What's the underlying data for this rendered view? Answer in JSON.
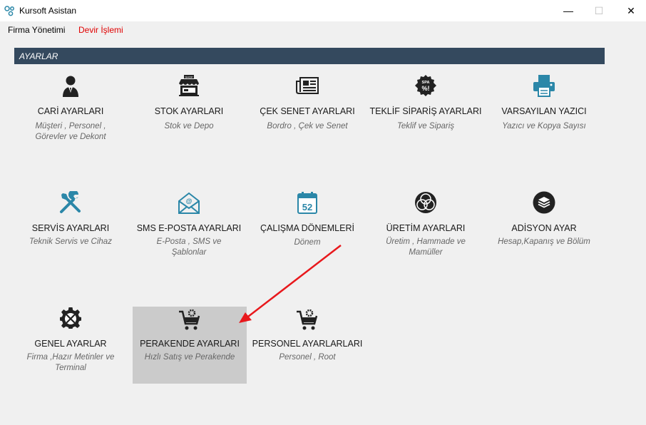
{
  "window": {
    "title": "Kursoft Asistan",
    "controls": {
      "minimize": "—",
      "maximize": "☐",
      "close": "✕"
    }
  },
  "menu": [
    {
      "label": "Firma Yönetimi"
    },
    {
      "label": "Devir İşlemi"
    }
  ],
  "section": {
    "title": "AYARLAR"
  },
  "tiles": [
    {
      "label": "CARİ AYARLARI",
      "sub": "Müşteri , Personel , Görevler ve Dekont",
      "icon": "user-icon"
    },
    {
      "label": "STOK AYARLARI",
      "sub": "Stok ve Depo",
      "icon": "shop-icon"
    },
    {
      "label": "ÇEK SENET AYARLARI",
      "sub": "Bordro , Çek ve Senet",
      "icon": "newspaper-icon"
    },
    {
      "label": "TEKLİF SİPARİŞ AYARLARI",
      "sub": "Teklif ve Sipariş",
      "icon": "spa-discount-icon"
    },
    {
      "label": "VARSAYILAN YAZICI",
      "sub": "Yazıcı ve Kopya Sayısı",
      "icon": "printer-icon"
    },
    {
      "label": "SERVİS AYARLARI",
      "sub": "Teknik Servis ve Cihaz",
      "icon": "tools-icon"
    },
    {
      "label": "SMS E-POSTA AYARLARI",
      "sub": "E-Posta , SMS ve Şablonlar",
      "icon": "email-icon"
    },
    {
      "label": "ÇALIŞMA DÖNEMLERİ",
      "sub": "Dönem",
      "icon": "calendar-icon"
    },
    {
      "label": "ÜRETİM AYARLARI",
      "sub": "Üretim , Hammade ve Mamüller",
      "icon": "circles-icon"
    },
    {
      "label": "ADİSYON AYAR",
      "sub": "Hesap,Kapanış ve Bölüm",
      "icon": "layers-icon"
    },
    {
      "label": "GENEL AYARLAR",
      "sub": "Firma ,Hazır Metinler ve Terminal",
      "icon": "gear-tools-icon"
    },
    {
      "label": "PERAKENDE AYARLARI",
      "sub": "Hızlı Satış ve Perakende",
      "icon": "cart-gear-icon"
    },
    {
      "label": "PERSONEL AYARLARLARI",
      "sub": "Personel , Root",
      "icon": "cart-gear-icon"
    }
  ],
  "colors": {
    "header_bg": "#34495e",
    "accent_teal": "#2b87a8",
    "menu_red": "#e00000",
    "selected_bg": "#cbcbcb",
    "arrow": "#e8181c"
  }
}
